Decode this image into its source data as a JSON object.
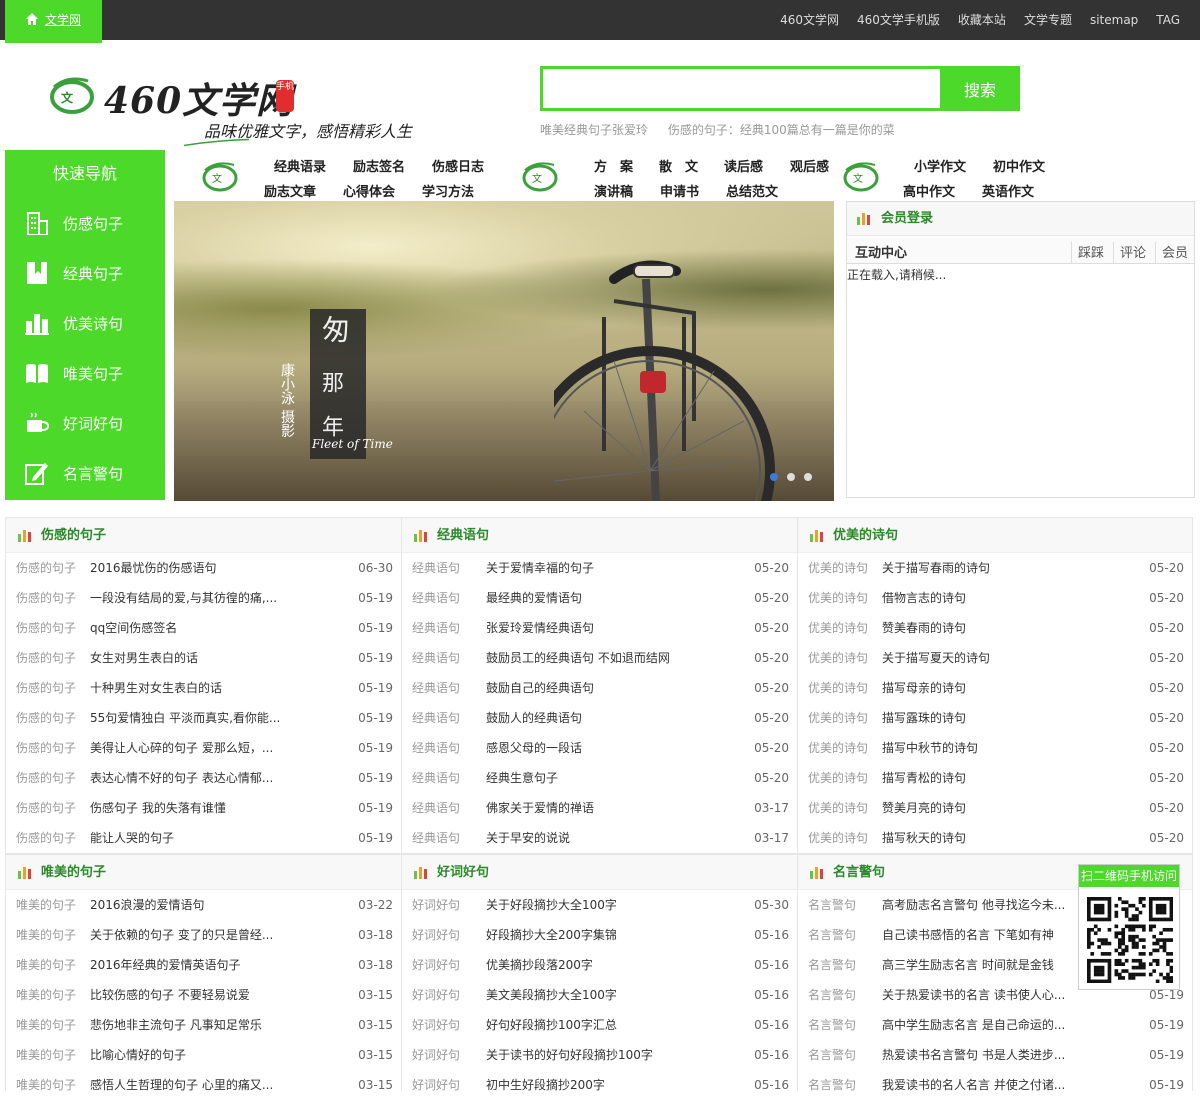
{
  "topbar": {
    "home_label": "文学网",
    "links": [
      "460文学网",
      "460文学手机版",
      "收藏本站",
      "文学专题",
      "sitemap",
      "TAG"
    ]
  },
  "logo": {
    "name": "460文学网",
    "stamp": "手机",
    "slogan": "品味优雅文字，感悟精彩人生"
  },
  "search": {
    "value": "",
    "button_label": "搜索",
    "hot_links": [
      "唯美经典句子张爱玲",
      "伤感的句子：经典100篇总有一篇是你的菜"
    ]
  },
  "sidenav": {
    "title": "快速导航",
    "items": [
      {
        "label": "伤感句子",
        "icon": "building-icon"
      },
      {
        "label": "经典句子",
        "icon": "bookmark-icon"
      },
      {
        "label": "优美诗句",
        "icon": "bar-chart-icon"
      },
      {
        "label": "唯美句子",
        "icon": "open-book-icon"
      },
      {
        "label": "好词好句",
        "icon": "coffee-cup-icon"
      },
      {
        "label": "名言警句",
        "icon": "edit-icon"
      }
    ]
  },
  "catnav": {
    "group1": [
      "经典语录",
      "励志签名",
      "伤感日志",
      "励志文章",
      "心得体会",
      "学习方法"
    ],
    "group2": [
      "方　案",
      "散　文",
      "读后感",
      "观后感",
      "演讲稿",
      "申请书",
      "总结范文"
    ],
    "group3": [
      "小学作文",
      "初中作文",
      "高中作文",
      "英语作文"
    ]
  },
  "slider": {
    "title_chars": [
      "匆",
      "那",
      "年"
    ],
    "author": "康小泳 摄影",
    "caption": "Fleet of Time",
    "active_slide": 1,
    "slide_count": 3
  },
  "login": {
    "title": "会员登录",
    "tabs": [
      "互动中心",
      "踩踩",
      "评论",
      "会员"
    ],
    "loading_text": "正在载入,请稍候..."
  },
  "panels": [
    {
      "title": "伤感的句子",
      "items": [
        {
          "cat": "伤感的句子",
          "title": "2016最忧伤的伤感语句",
          "date": "06-30"
        },
        {
          "cat": "伤感的句子",
          "title": "一段没有结局的爱,与其彷徨的痛,...",
          "date": "05-19"
        },
        {
          "cat": "伤感的句子",
          "title": "qq空间伤感签名",
          "date": "05-19"
        },
        {
          "cat": "伤感的句子",
          "title": "女生对男生表白的话",
          "date": "05-19"
        },
        {
          "cat": "伤感的句子",
          "title": "十种男生对女生表白的话",
          "date": "05-19"
        },
        {
          "cat": "伤感的句子",
          "title": "55句爱情独白  平淡而真实,看你能...",
          "date": "05-19"
        },
        {
          "cat": "伤感的句子",
          "title": "美得让人心碎的句子  爱那么短，...",
          "date": "05-19"
        },
        {
          "cat": "伤感的句子",
          "title": "表达心情不好的句子  表达心情郁...",
          "date": "05-19"
        },
        {
          "cat": "伤感的句子",
          "title": "伤感句子  我的失落有谁懂",
          "date": "05-19"
        },
        {
          "cat": "伤感的句子",
          "title": "能让人哭的句子",
          "date": "05-19"
        }
      ]
    },
    {
      "title": "经典语句",
      "items": [
        {
          "cat": "经典语句",
          "title": "关于爱情幸福的句子",
          "date": "05-20"
        },
        {
          "cat": "经典语句",
          "title": "最经典的爱情语句",
          "date": "05-20"
        },
        {
          "cat": "经典语句",
          "title": "张爱玲爱情经典语句",
          "date": "05-20"
        },
        {
          "cat": "经典语句",
          "title": "鼓励员工的经典语句  不如退而结网",
          "date": "05-20"
        },
        {
          "cat": "经典语句",
          "title": "鼓励自己的经典语句",
          "date": "05-20"
        },
        {
          "cat": "经典语句",
          "title": "鼓励人的经典语句",
          "date": "05-20"
        },
        {
          "cat": "经典语句",
          "title": "感恩父母的一段话",
          "date": "05-20"
        },
        {
          "cat": "经典语句",
          "title": "经典生意句子",
          "date": "05-20"
        },
        {
          "cat": "经典语句",
          "title": "佛家关于爱情的禅语",
          "date": "03-17"
        },
        {
          "cat": "经典语句",
          "title": "关于早安的说说",
          "date": "03-17"
        }
      ]
    },
    {
      "title": "优美的诗句",
      "items": [
        {
          "cat": "优美的诗句",
          "title": "关于描写春雨的诗句",
          "date": "05-20"
        },
        {
          "cat": "优美的诗句",
          "title": "借物言志的诗句",
          "date": "05-20"
        },
        {
          "cat": "优美的诗句",
          "title": "赞美春雨的诗句",
          "date": "05-20"
        },
        {
          "cat": "优美的诗句",
          "title": "关于描写夏天的诗句",
          "date": "05-20"
        },
        {
          "cat": "优美的诗句",
          "title": "描写母亲的诗句",
          "date": "05-20"
        },
        {
          "cat": "优美的诗句",
          "title": "描写露珠的诗句",
          "date": "05-20"
        },
        {
          "cat": "优美的诗句",
          "title": "描写中秋节的诗句",
          "date": "05-20"
        },
        {
          "cat": "优美的诗句",
          "title": "描写青松的诗句",
          "date": "05-20"
        },
        {
          "cat": "优美的诗句",
          "title": "赞美月亮的诗句",
          "date": "05-20"
        },
        {
          "cat": "优美的诗句",
          "title": "描写秋天的诗句",
          "date": "05-20"
        }
      ]
    },
    {
      "title": "唯美的句子",
      "items": [
        {
          "cat": "唯美的句子",
          "title": "2016浪漫的爱情语句",
          "date": "03-22"
        },
        {
          "cat": "唯美的句子",
          "title": "关于依赖的句子  变了的只是曾经...",
          "date": "03-18"
        },
        {
          "cat": "唯美的句子",
          "title": "2016年经典的爱情英语句子",
          "date": "03-18"
        },
        {
          "cat": "唯美的句子",
          "title": "比较伤感的句子  不要轻易说爱",
          "date": "03-15"
        },
        {
          "cat": "唯美的句子",
          "title": "悲伤地非主流句子  凡事知足常乐",
          "date": "03-15"
        },
        {
          "cat": "唯美的句子",
          "title": "比喻心情好的句子",
          "date": "03-15"
        },
        {
          "cat": "唯美的句子",
          "title": "感悟人生哲理的句子  心里的痛又...",
          "date": "03-15"
        }
      ]
    },
    {
      "title": "好词好句",
      "items": [
        {
          "cat": "好词好句",
          "title": "关于好段摘抄大全100字",
          "date": "05-30"
        },
        {
          "cat": "好词好句",
          "title": "好段摘抄大全200字集锦",
          "date": "05-16"
        },
        {
          "cat": "好词好句",
          "title": "优美摘抄段落200字",
          "date": "05-16"
        },
        {
          "cat": "好词好句",
          "title": "美文美段摘抄大全100字",
          "date": "05-16"
        },
        {
          "cat": "好词好句",
          "title": "好句好段摘抄100字汇总",
          "date": "05-16"
        },
        {
          "cat": "好词好句",
          "title": "关于读书的好句好段摘抄100字",
          "date": "05-16"
        },
        {
          "cat": "好词好句",
          "title": "初中生好段摘抄200字",
          "date": "05-16"
        }
      ]
    },
    {
      "title": "名言警句",
      "items": [
        {
          "cat": "名言警句",
          "title": "高考励志名言警句  他寻找迄今未...",
          "date": ""
        },
        {
          "cat": "名言警句",
          "title": "自己读书感悟的名言  下笔如有神",
          "date": ""
        },
        {
          "cat": "名言警句",
          "title": "高三学生励志名言  时间就是金钱",
          "date": ""
        },
        {
          "cat": "名言警句",
          "title": "关于热爱读书的名言  读书使人心...",
          "date": "05-19"
        },
        {
          "cat": "名言警句",
          "title": "高中学生励志名言  是自己命运的...",
          "date": "05-19"
        },
        {
          "cat": "名言警句",
          "title": "热爱读书名言警句  书是人类进步...",
          "date": "05-19"
        },
        {
          "cat": "名言警句",
          "title": "我爱读书的名人名言  并使之付诸...",
          "date": "05-19"
        }
      ]
    }
  ],
  "qr": {
    "label": "扫二维码手机访问"
  },
  "colors": {
    "brand": "#4dd92a",
    "topbar": "#333333",
    "panel_title": "#2a8a2a"
  }
}
